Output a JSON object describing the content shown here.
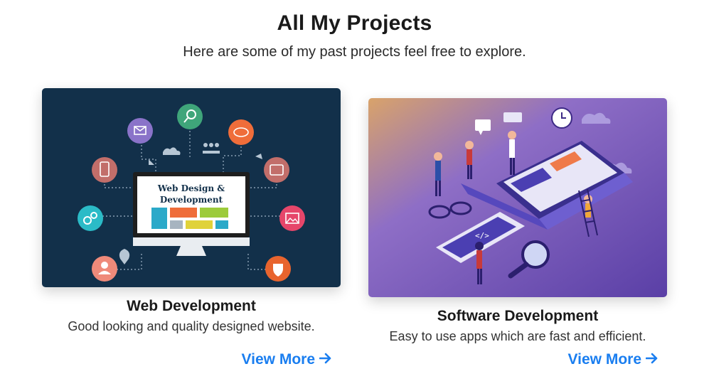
{
  "header": {
    "title": "All My Projects",
    "subtitle": "Here are some of my past projects feel free to explore."
  },
  "projects": [
    {
      "title": "Web Development",
      "description": "Good looking and quality designed website.",
      "link_label": "View More",
      "image": {
        "icon": "web-design-illustration",
        "screen_text_1": "Web Design &",
        "screen_text_2": "Development"
      }
    },
    {
      "title": "Software Development",
      "description": "Easy to use apps which are fast and efficient.",
      "link_label": "View More",
      "image": {
        "icon": "software-development-illustration"
      }
    }
  ],
  "colors": {
    "accent": "#1a7ef0",
    "card1_bg": "#12304a",
    "card2_bg_start": "#d9a36a",
    "card2_bg_end": "#6b4fb8"
  }
}
